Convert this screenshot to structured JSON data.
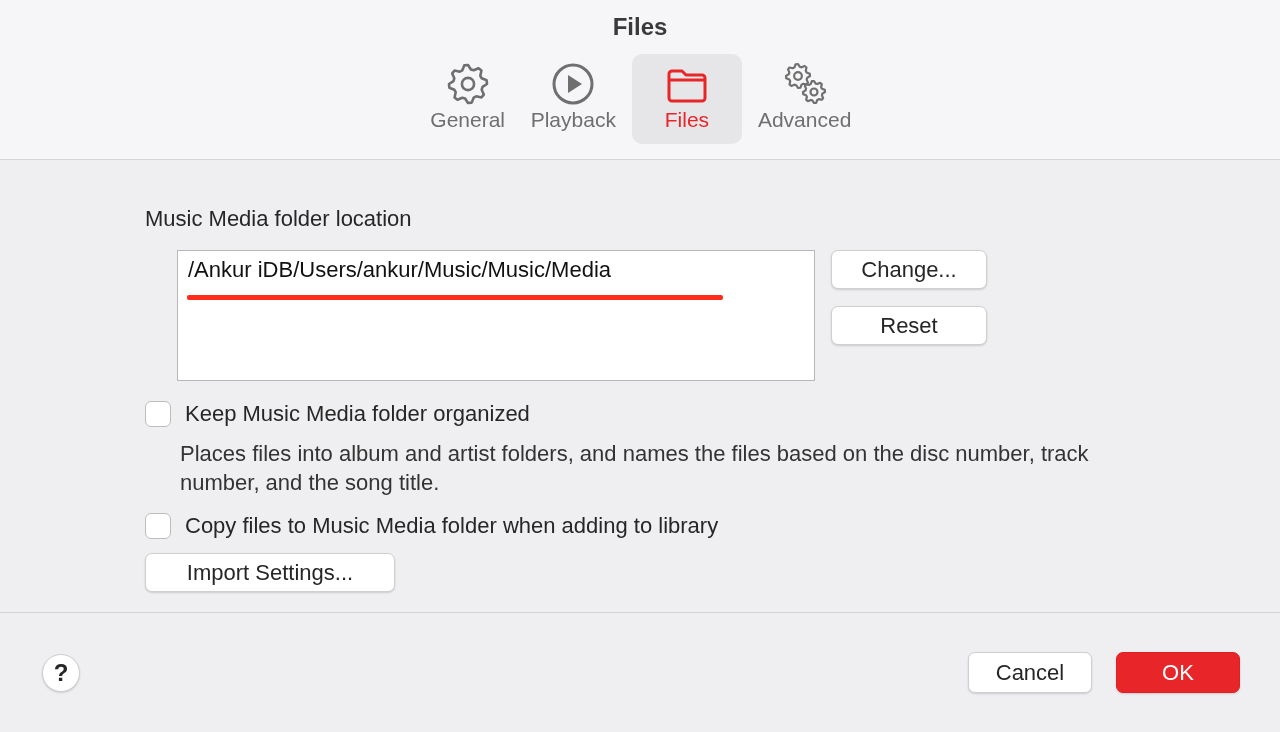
{
  "window": {
    "title": "Files"
  },
  "tabs": [
    {
      "label": "General",
      "selected": false
    },
    {
      "label": "Playback",
      "selected": false
    },
    {
      "label": "Files",
      "selected": true
    },
    {
      "label": "Advanced",
      "selected": false
    }
  ],
  "folder_location": {
    "label": "Music Media folder location",
    "path": "/Ankur iDB/Users/ankur/Music/Music/Media",
    "buttons": [
      "Change...",
      "Reset"
    ]
  },
  "options": [
    {
      "label": "Keep Music Media folder organized",
      "checked": false,
      "description": "Places files into album and artist folders, and names the files based on the disc number, track number, and the song title."
    },
    {
      "label": "Copy files to Music Media folder when adding to library",
      "checked": false
    }
  ],
  "import_button": "Import Settings...",
  "footer": {
    "help": "?",
    "buttons": [
      {
        "label": "Cancel",
        "kind": "normal"
      },
      {
        "label": "OK",
        "kind": "default"
      }
    ]
  }
}
